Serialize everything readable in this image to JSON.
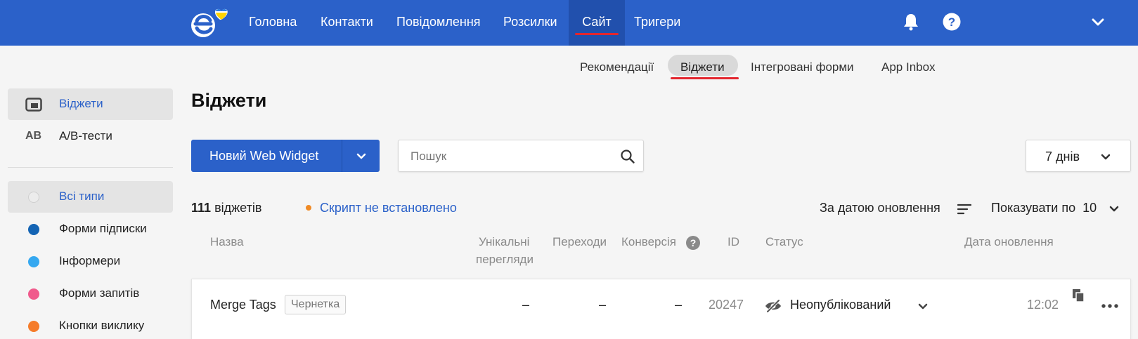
{
  "colors": {
    "brand": "#2b61c9",
    "accent_underline": "#e3262e",
    "warning_dot": "#f08a24"
  },
  "topnav": {
    "items": [
      {
        "label": "Головна"
      },
      {
        "label": "Контакти"
      },
      {
        "label": "Повідомлення"
      },
      {
        "label": "Розсилки"
      },
      {
        "label": "Сайт",
        "active": true
      },
      {
        "label": "Тригери"
      }
    ],
    "icons": [
      "heart-logo-icon",
      "bell-icon",
      "help-icon",
      "chevron-down-icon"
    ]
  },
  "subnav": {
    "items": [
      {
        "label": "Рекомендації"
      },
      {
        "label": "Віджети",
        "active": true
      },
      {
        "label": "Інтегровані форми"
      },
      {
        "label": "App Inbox"
      }
    ]
  },
  "sidebar": {
    "sections": [
      {
        "label": "Віджети",
        "active": true,
        "icon": "widget-icon"
      },
      {
        "label": "A/B-тести",
        "icon_text": "AB"
      }
    ],
    "types": [
      {
        "label": "Всі типи",
        "active": true,
        "color": "#ececec"
      },
      {
        "label": "Форми підписки",
        "color": "#1464b4"
      },
      {
        "label": "Інформери",
        "color": "#35a8f0"
      },
      {
        "label": "Форми запитів",
        "color": "#f05a8c"
      },
      {
        "label": "Кнопки виклику",
        "color": "#f57c2a"
      }
    ]
  },
  "main": {
    "title": "Віджети",
    "new_button_label": "Новий Web Widget",
    "search_placeholder": "Пошук",
    "period_label": "7 днів",
    "count_number": "111",
    "count_suffix": "віджетів",
    "script_warning": "Скрипт не встановлено",
    "sort_label": "За датою оновлення",
    "perpage_label": "Показувати по",
    "perpage_value": "10"
  },
  "table": {
    "headers": {
      "name": "Назва",
      "unique_views_1": "Унікальні",
      "unique_views_2": "перегляди",
      "clicks": "Переходи",
      "conversion": "Конверсія",
      "id": "ID",
      "status": "Статус",
      "updated": "Дата оновлення"
    },
    "rows": [
      {
        "name": "Merge Tags",
        "badge": "Чернетка",
        "unique_views": "–",
        "clicks": "–",
        "conversion": "–",
        "id": "20247",
        "status": "Неопублікований",
        "updated": "12:02"
      }
    ]
  }
}
